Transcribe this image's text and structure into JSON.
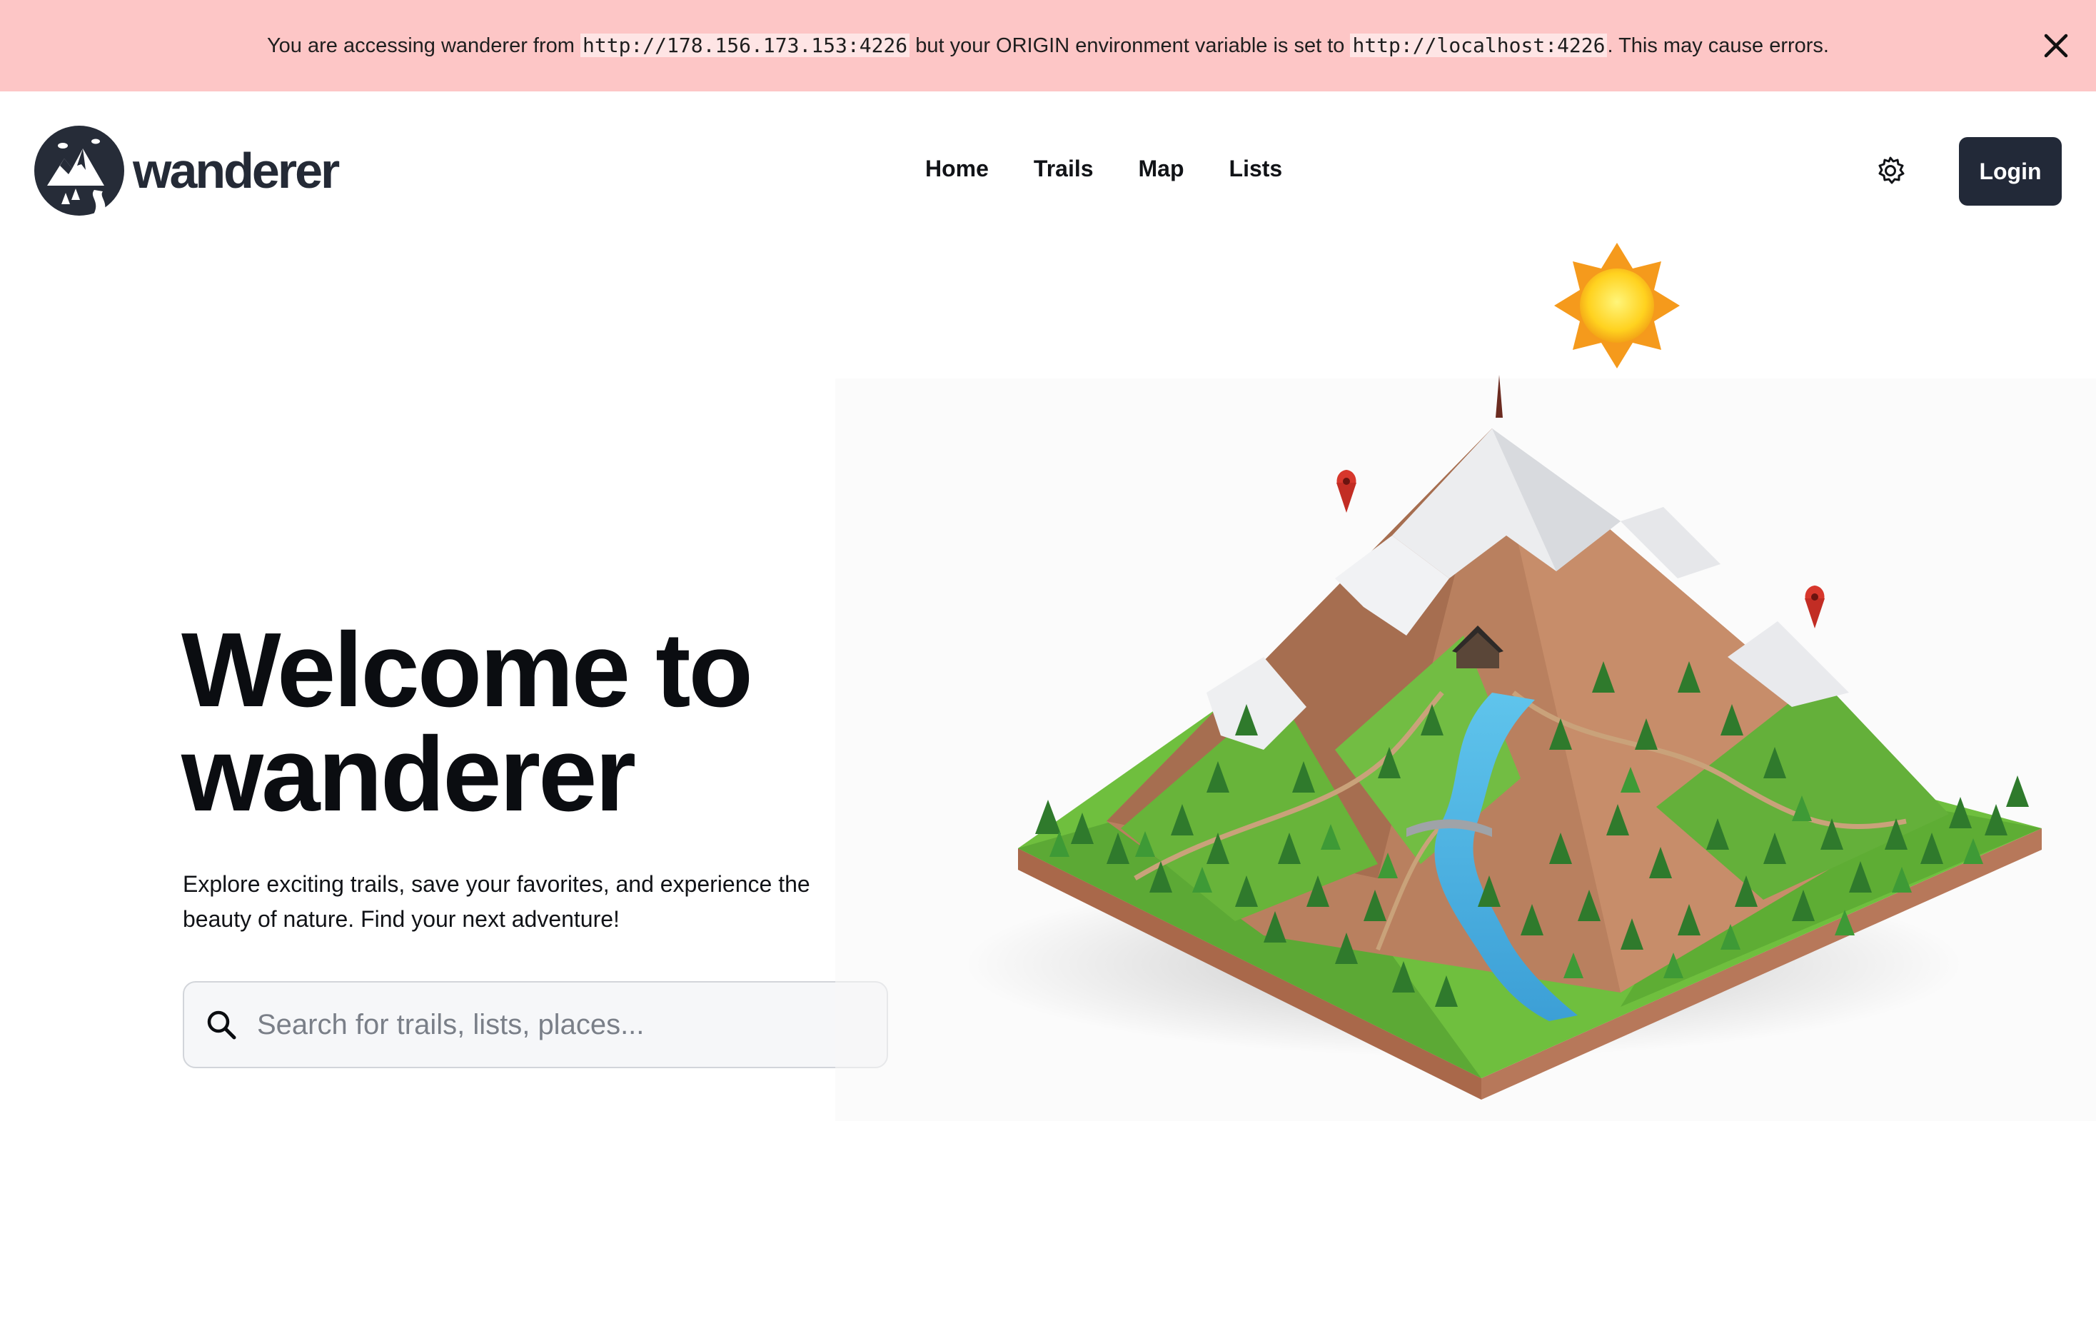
{
  "banner": {
    "prefix": "You are accessing wanderer from ",
    "accessed_url": "http://178.156.173.153:4226",
    "middle": " but your ORIGIN environment variable is set to ",
    "origin_url": "http://localhost:4226",
    "suffix": ". This may cause errors.",
    "close_icon": "close-icon",
    "background_color": "#fdc6c6"
  },
  "header": {
    "logo_text": "wanderer",
    "nav": [
      "Home",
      "Trails",
      "Map",
      "Lists"
    ],
    "theme_icon": "gear-icon",
    "login_label": "Login",
    "login_color": "#222938"
  },
  "hero": {
    "title_line1": "Welcome to",
    "title_line2": "wanderer",
    "subtitle": "Explore exciting trails, save your favorites, and experience the beauty of nature. Find your next adventure!",
    "search_placeholder": "Search for trails, lists, places...",
    "search_icon": "search-icon",
    "illustration": "low-poly-mountain-illustration"
  }
}
